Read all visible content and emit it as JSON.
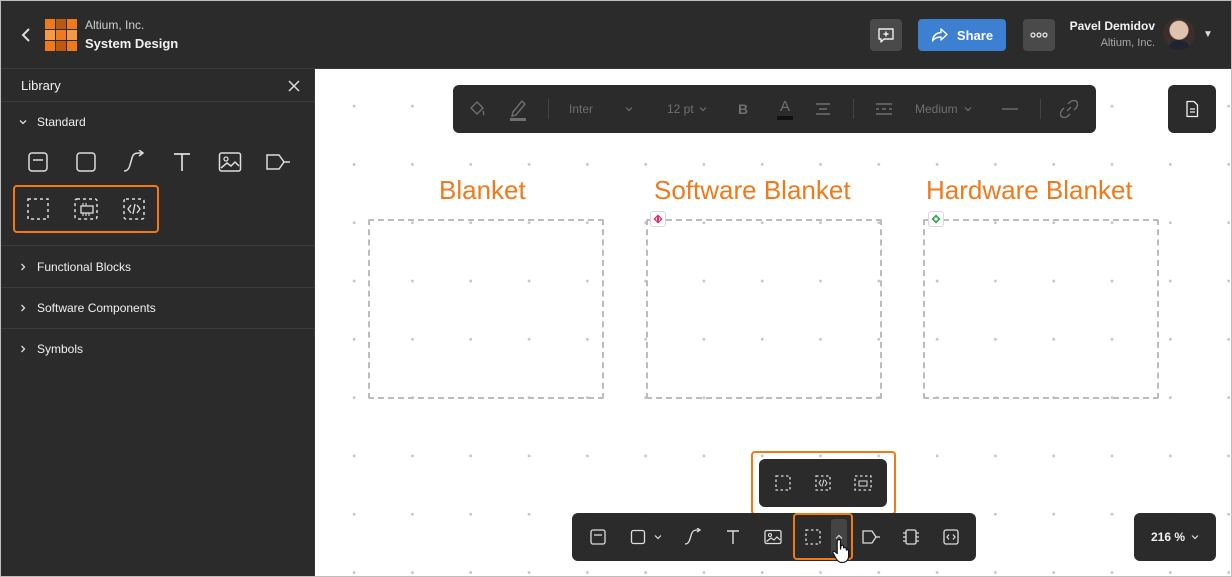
{
  "header": {
    "org": "Altium, Inc.",
    "project": "System Design",
    "share_label": "Share",
    "user_name": "Pavel Demidov",
    "user_org": "Altium, Inc."
  },
  "sidebar": {
    "title": "Library",
    "sections": [
      {
        "label": "Standard",
        "expanded": true
      },
      {
        "label": "Functional Blocks",
        "expanded": false
      },
      {
        "label": "Software Components",
        "expanded": false
      },
      {
        "label": "Symbols",
        "expanded": false
      }
    ],
    "standard_icons": [
      "block-icon",
      "rectangle-icon",
      "connector-icon",
      "text-icon",
      "image-icon",
      "port-icon"
    ],
    "highlighted_icons": [
      "blanket-icon",
      "hardware-blanket-icon",
      "software-blanket-icon"
    ]
  },
  "format_toolbar": {
    "font": "Inter",
    "size": "12 pt",
    "bold": "B",
    "color_letter": "A",
    "line_weight": "Medium"
  },
  "canvas": {
    "blankets": [
      {
        "title": "Blanket",
        "badge": "none"
      },
      {
        "title": "Software Blanket",
        "badge": "software"
      },
      {
        "title": "Hardware Blanket",
        "badge": "hardware"
      }
    ]
  },
  "zoom": {
    "label": "216 %"
  },
  "colors": {
    "accent": "#f07a1a",
    "share": "#3d7fd0",
    "panel": "#2b2b2b",
    "software_badge": "#e0245e",
    "hardware_badge": "#2ea44f"
  }
}
